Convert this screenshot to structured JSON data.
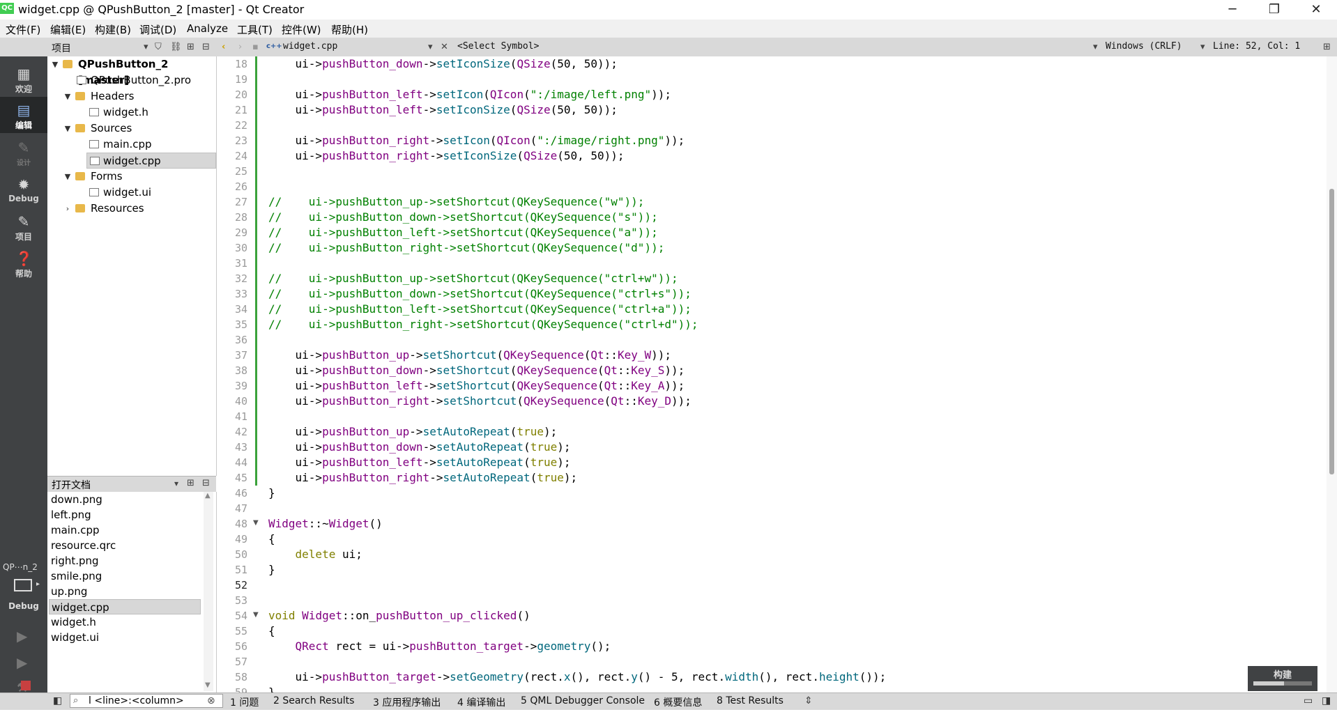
{
  "window": {
    "title": "widget.cpp @ QPushButton_2 [master] - Qt Creator",
    "app_icon": "QC",
    "minimize": "─",
    "maximize": "❐",
    "close": "✕"
  },
  "menu": [
    "文件(F)",
    "编辑(E)",
    "构建(B)",
    "调试(D)",
    "Analyze",
    "工具(T)",
    "控件(W)",
    "帮助(H)"
  ],
  "toolbar": {
    "project_label": "项目",
    "file_name": "widget.cpp",
    "symbol": "<Select Symbol>",
    "encoding": "Windows (CRLF)",
    "position": "Line: 52, Col: 1"
  },
  "modes": [
    {
      "label": "欢迎",
      "icon": "grid-icon"
    },
    {
      "label": "编辑",
      "icon": "edit-icon"
    },
    {
      "label": "设计",
      "icon": "design-icon"
    },
    {
      "label": "Debug",
      "icon": "bug-icon"
    },
    {
      "label": "项目",
      "icon": "wrench-icon"
    },
    {
      "label": "帮助",
      "icon": "help-icon"
    }
  ],
  "kit": {
    "name": "QP⋯n_2",
    "mode": "Debug"
  },
  "tree": [
    {
      "label": "QPushButton_2 [master]",
      "depth": 0,
      "arrow": "▼",
      "type": "project"
    },
    {
      "label": "QPushButton_2.pro",
      "depth": 1,
      "arrow": "",
      "type": "file"
    },
    {
      "label": "Headers",
      "depth": 1,
      "arrow": "▼",
      "type": "folder"
    },
    {
      "label": "widget.h",
      "depth": 2,
      "arrow": "",
      "type": "file"
    },
    {
      "label": "Sources",
      "depth": 1,
      "arrow": "▼",
      "type": "folder"
    },
    {
      "label": "main.cpp",
      "depth": 2,
      "arrow": "",
      "type": "file"
    },
    {
      "label": "widget.cpp",
      "depth": 2,
      "arrow": "",
      "type": "file",
      "selected": true
    },
    {
      "label": "Forms",
      "depth": 1,
      "arrow": "▼",
      "type": "folder"
    },
    {
      "label": "widget.ui",
      "depth": 2,
      "arrow": "",
      "type": "file"
    },
    {
      "label": "Resources",
      "depth": 1,
      "arrow": "›",
      "type": "folder"
    }
  ],
  "open_docs": {
    "title": "打开文档",
    "items": [
      "down.png",
      "left.png",
      "main.cpp",
      "resource.qrc",
      "right.png",
      "smile.png",
      "up.png",
      "widget.cpp",
      "widget.h",
      "widget.ui"
    ],
    "selected_index": 7
  },
  "code": [
    {
      "n": 18,
      "t": "    ui->pushButton_down->setIconSize(QSize(50, 50));"
    },
    {
      "n": 19,
      "t": ""
    },
    {
      "n": 20,
      "t": "    ui->pushButton_left->setIcon(QIcon(\":/image/left.png\"));"
    },
    {
      "n": 21,
      "t": "    ui->pushButton_left->setIconSize(QSize(50, 50));"
    },
    {
      "n": 22,
      "t": ""
    },
    {
      "n": 23,
      "t": "    ui->pushButton_right->setIcon(QIcon(\":/image/right.png\"));"
    },
    {
      "n": 24,
      "t": "    ui->pushButton_right->setIconSize(QSize(50, 50));"
    },
    {
      "n": 25,
      "t": ""
    },
    {
      "n": 26,
      "t": ""
    },
    {
      "n": 27,
      "t": "//    ui->pushButton_up->setShortcut(QKeySequence(\"w\"));"
    },
    {
      "n": 28,
      "t": "//    ui->pushButton_down->setShortcut(QKeySequence(\"s\"));"
    },
    {
      "n": 29,
      "t": "//    ui->pushButton_left->setShortcut(QKeySequence(\"a\"));"
    },
    {
      "n": 30,
      "t": "//    ui->pushButton_right->setShortcut(QKeySequence(\"d\"));"
    },
    {
      "n": 31,
      "t": ""
    },
    {
      "n": 32,
      "t": "//    ui->pushButton_up->setShortcut(QKeySequence(\"ctrl+w\"));"
    },
    {
      "n": 33,
      "t": "//    ui->pushButton_down->setShortcut(QKeySequence(\"ctrl+s\"));"
    },
    {
      "n": 34,
      "t": "//    ui->pushButton_left->setShortcut(QKeySequence(\"ctrl+a\"));"
    },
    {
      "n": 35,
      "t": "//    ui->pushButton_right->setShortcut(QKeySequence(\"ctrl+d\"));"
    },
    {
      "n": 36,
      "t": ""
    },
    {
      "n": 37,
      "t": "    ui->pushButton_up->setShortcut(QKeySequence(Qt::Key_W));"
    },
    {
      "n": 38,
      "t": "    ui->pushButton_down->setShortcut(QKeySequence(Qt::Key_S));"
    },
    {
      "n": 39,
      "t": "    ui->pushButton_left->setShortcut(QKeySequence(Qt::Key_A));"
    },
    {
      "n": 40,
      "t": "    ui->pushButton_right->setShortcut(QKeySequence(Qt::Key_D));"
    },
    {
      "n": 41,
      "t": ""
    },
    {
      "n": 42,
      "t": "    ui->pushButton_up->setAutoRepeat(true);"
    },
    {
      "n": 43,
      "t": "    ui->pushButton_down->setAutoRepeat(true);"
    },
    {
      "n": 44,
      "t": "    ui->pushButton_left->setAutoRepeat(true);"
    },
    {
      "n": 45,
      "t": "    ui->pushButton_right->setAutoRepeat(true);"
    },
    {
      "n": 46,
      "t": "}"
    },
    {
      "n": 47,
      "t": ""
    },
    {
      "n": 48,
      "t": "Widget::~Widget()"
    },
    {
      "n": 49,
      "t": "{"
    },
    {
      "n": 50,
      "t": "    delete ui;"
    },
    {
      "n": 51,
      "t": "}"
    },
    {
      "n": 52,
      "t": ""
    },
    {
      "n": 53,
      "t": ""
    },
    {
      "n": 54,
      "t": "void Widget::on_pushButton_up_clicked()"
    },
    {
      "n": 55,
      "t": "{"
    },
    {
      "n": 56,
      "t": "    QRect rect = ui->pushButton_target->geometry();"
    },
    {
      "n": 57,
      "t": ""
    },
    {
      "n": 58,
      "t": "    ui->pushButton_target->setGeometry(rect.x(), rect.y() - 5, rect.width(), rect.height());"
    },
    {
      "n": 59,
      "t": "}"
    }
  ],
  "status": {
    "locator_placeholder": "l <line>:<column>",
    "tabs": [
      "1 问题",
      "2 Search Results",
      "3 应用程序输出",
      "4 编译输出",
      "5 QML Debugger Console",
      "6 概要信息",
      "8 Test Results"
    ]
  },
  "build_popup": "构建",
  "colors": {
    "keyword": "#808000",
    "func": "#00677c",
    "string": "#008000",
    "comment": "#008000",
    "member": "#800080",
    "type": "#800080"
  }
}
